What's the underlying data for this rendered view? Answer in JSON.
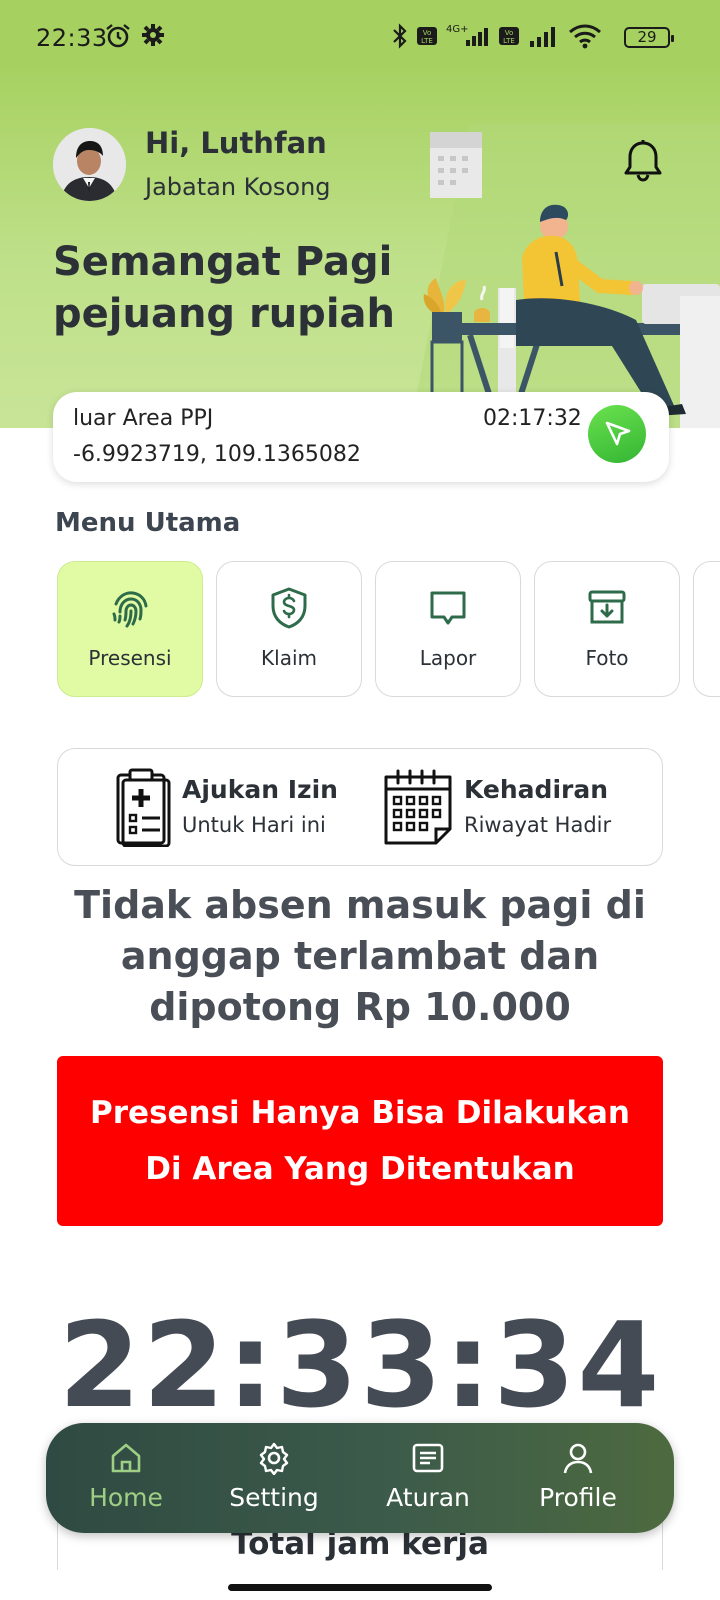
{
  "status_bar": {
    "time": "22:33",
    "battery": "29",
    "icons": [
      "alarm-icon",
      "gear-icon",
      "bluetooth-icon",
      "volte-icon",
      "signal-4g-icon",
      "volte-icon",
      "signal-icon",
      "wifi-icon"
    ]
  },
  "header": {
    "greeting": "Hi, Luthfan",
    "position": "Jabatan Kosong",
    "motto": "Semangat Pagi pejuang rupiah",
    "bell_icon": "bell-icon"
  },
  "location": {
    "area": "luar Area PPJ",
    "coordinates": "-6.9923719, 109.1365082",
    "time": "02:17:32",
    "send_icon": "send-icon"
  },
  "menu": {
    "title": "Menu Utama",
    "items": [
      {
        "label": "Presensi",
        "icon": "fingerprint-icon",
        "active": true
      },
      {
        "label": "Klaim",
        "icon": "shield-dollar-icon",
        "active": false
      },
      {
        "label": "Lapor",
        "icon": "message-icon",
        "active": false
      },
      {
        "label": "Foto",
        "icon": "archive-download-icon",
        "active": false
      }
    ]
  },
  "actions": {
    "izin": {
      "title": "Ajukan Izin",
      "subtitle": "Untuk Hari ini",
      "icon": "medical-clipboard-icon"
    },
    "kehadiran": {
      "title": "Kehadiran",
      "subtitle": "Riwayat Hadir",
      "icon": "calendar-icon"
    }
  },
  "notice": "Tidak absen masuk pagi di anggap terlambat dan dipotong Rp 10.000",
  "warning": {
    "line1": "Presensi Hanya Bisa Dilakukan",
    "line2": "Di Area Yang Ditentukan"
  },
  "clock": "22:33:34",
  "total": {
    "title": "Total jam kerja"
  },
  "nav": {
    "items": [
      {
        "label": "Home",
        "icon": "home-icon",
        "active": true
      },
      {
        "label": "Setting",
        "icon": "gear-icon",
        "active": false
      },
      {
        "label": "Aturan",
        "icon": "document-icon",
        "active": false
      },
      {
        "label": "Profile",
        "icon": "user-icon",
        "active": false
      }
    ]
  },
  "colors": {
    "header_green": "#a6d160",
    "active_tile": "#e1fba4",
    "icon_green": "#2e6b4a",
    "warning_red": "#ff0000",
    "nav_bg": "#2f4a42",
    "nav_active": "#9fcf84"
  }
}
